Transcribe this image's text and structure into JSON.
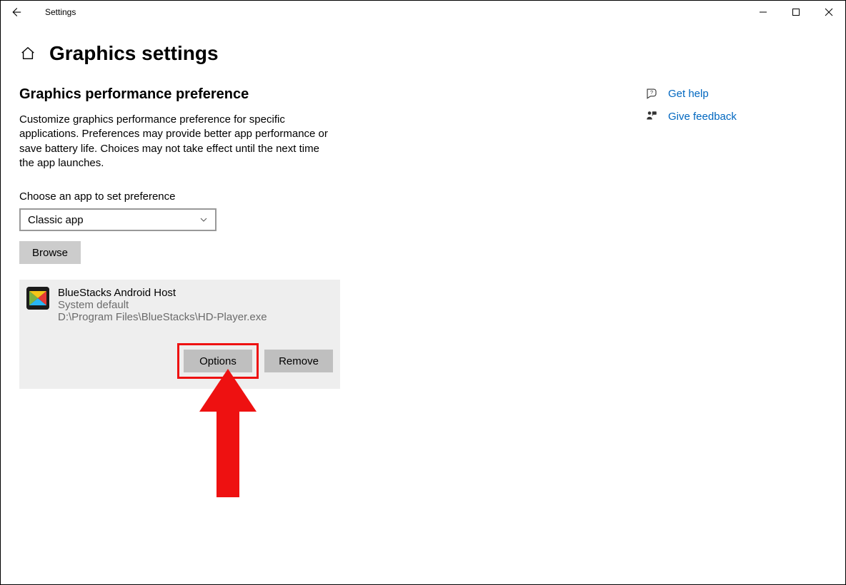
{
  "window": {
    "title": "Settings"
  },
  "page": {
    "title": "Graphics settings"
  },
  "section": {
    "heading": "Graphics performance preference",
    "description": "Customize graphics performance preference for specific applications. Preferences may provide better app performance or save battery life. Choices may not take effect until the next time the app launches.",
    "choose_label": "Choose an app to set preference",
    "dropdown_value": "Classic app",
    "browse_label": "Browse"
  },
  "app": {
    "name": "BlueStacks Android Host",
    "preference": "System default",
    "path": "D:\\Program Files\\BlueStacks\\HD-Player.exe",
    "options_label": "Options",
    "remove_label": "Remove"
  },
  "side": {
    "get_help": "Get help",
    "give_feedback": "Give feedback"
  }
}
